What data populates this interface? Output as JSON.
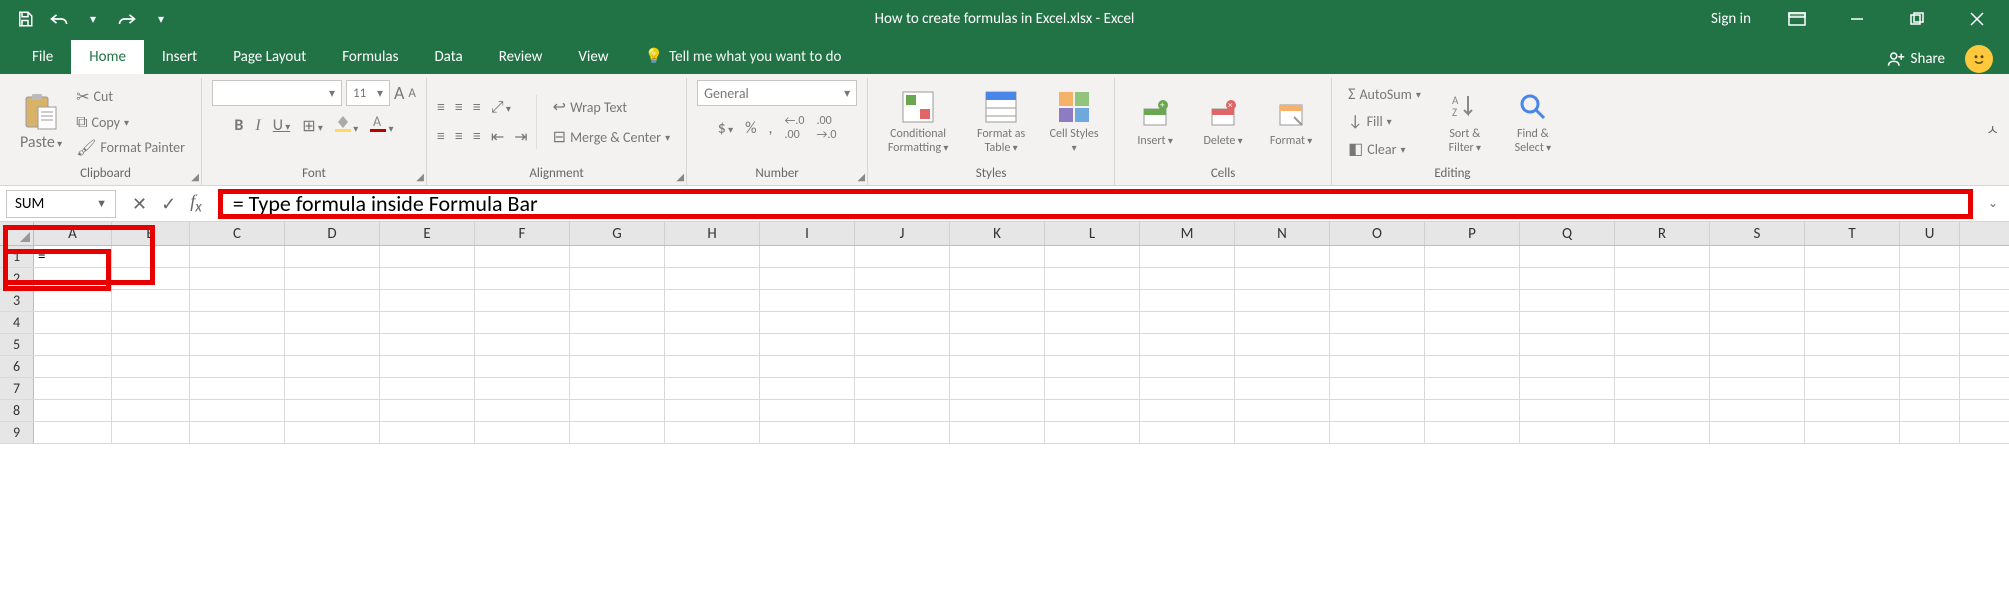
{
  "title": "How to create formulas in Excel.xlsx - Excel",
  "signin": "Sign in",
  "tabs": {
    "file": "File",
    "home": "Home",
    "insert": "Insert",
    "page_layout": "Page Layout",
    "formulas": "Formulas",
    "data": "Data",
    "review": "Review",
    "view": "View",
    "tellme": "Tell me what you want to do"
  },
  "share": "Share",
  "ribbon": {
    "clipboard": {
      "paste": "Paste",
      "cut": "Cut",
      "copy": "Copy",
      "format_painter": "Format Painter",
      "label": "Clipboard"
    },
    "font": {
      "name": "",
      "size": "11",
      "bold": "B",
      "italic": "I",
      "underline": "U",
      "label": "Font",
      "grow": "A",
      "shrink": "A"
    },
    "alignment": {
      "wrap": "Wrap Text",
      "merge": "Merge & Center",
      "label": "Alignment"
    },
    "number": {
      "format": "General",
      "currency": "$",
      "percent": "%",
      "comma": ",",
      "inc": ".0",
      "dec": ".00",
      "label": "Number"
    },
    "styles": {
      "cond": "Conditional Formatting",
      "fat": "Format as Table",
      "cell": "Cell Styles",
      "label": "Styles"
    },
    "cells": {
      "insert": "Insert",
      "delete": "Delete",
      "format": "Format",
      "label": "Cells"
    },
    "editing": {
      "autosum": "AutoSum",
      "fill": "Fill",
      "clear": "Clear",
      "sort": "Sort & Filter",
      "find": "Find & Select",
      "label": "Editing"
    }
  },
  "namebox": "SUM",
  "formula_bar_value": "= Type formula inside Formula Bar",
  "cell_A1": "=",
  "columns": [
    "A",
    "B",
    "C",
    "D",
    "E",
    "F",
    "G",
    "H",
    "I",
    "J",
    "K",
    "L",
    "M",
    "N",
    "O",
    "P",
    "Q",
    "R",
    "S",
    "T",
    "U"
  ],
  "row_numbers": [
    "1",
    "2",
    "3",
    "4",
    "5",
    "6",
    "7",
    "8",
    "9"
  ]
}
